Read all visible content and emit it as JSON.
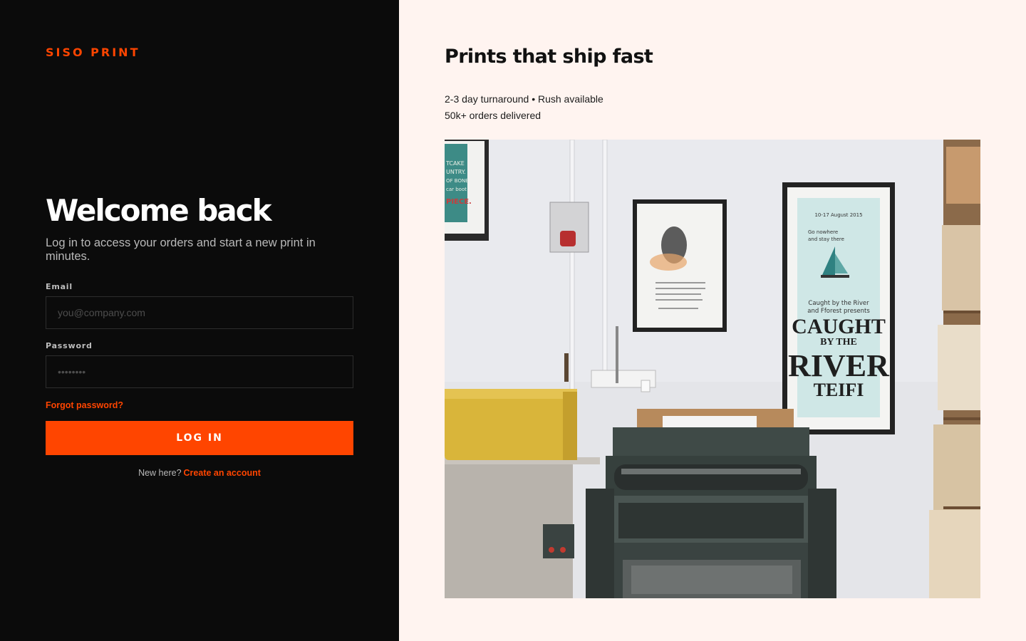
{
  "brand": {
    "name": "SISO PRINT"
  },
  "login": {
    "title": "Welcome back",
    "subtitle": "Log in to access your orders and start a new print in minutes.",
    "email_label": "Email",
    "email_placeholder": "you@company.com",
    "password_label": "Password",
    "password_placeholder": "••••••••",
    "forgot_password": "Forgot password?",
    "submit_label": "LOG IN",
    "signup_prompt": "New here?",
    "signup_link": "Create an account"
  },
  "promo": {
    "title": "Prints that ship fast",
    "lines": [
      "2-3 day turnaround • Rush available",
      "50k+ orders delivered"
    ],
    "photo": {
      "poster_date": "10-17 August 2015",
      "poster_tagline_1": "Go nowhere",
      "poster_tagline_2": "and stay there",
      "poster_intro_1": "Caught by the River",
      "poster_intro_2": "and Fforest presents",
      "poster_word_1": "CAUGHT",
      "poster_word_2": "BY THE",
      "poster_word_3": "RIVER",
      "poster_word_4": "TEIFI",
      "left_poster_1": "TCAKE",
      "left_poster_2": "UNTRY.",
      "left_poster_3": "OF BONE",
      "left_poster_4": "car boot",
      "left_poster_5": "PIECE."
    }
  },
  "colors": {
    "accent": "#ff4500",
    "left_background": "#0b0b0b",
    "right_background": "#fff4f0"
  }
}
